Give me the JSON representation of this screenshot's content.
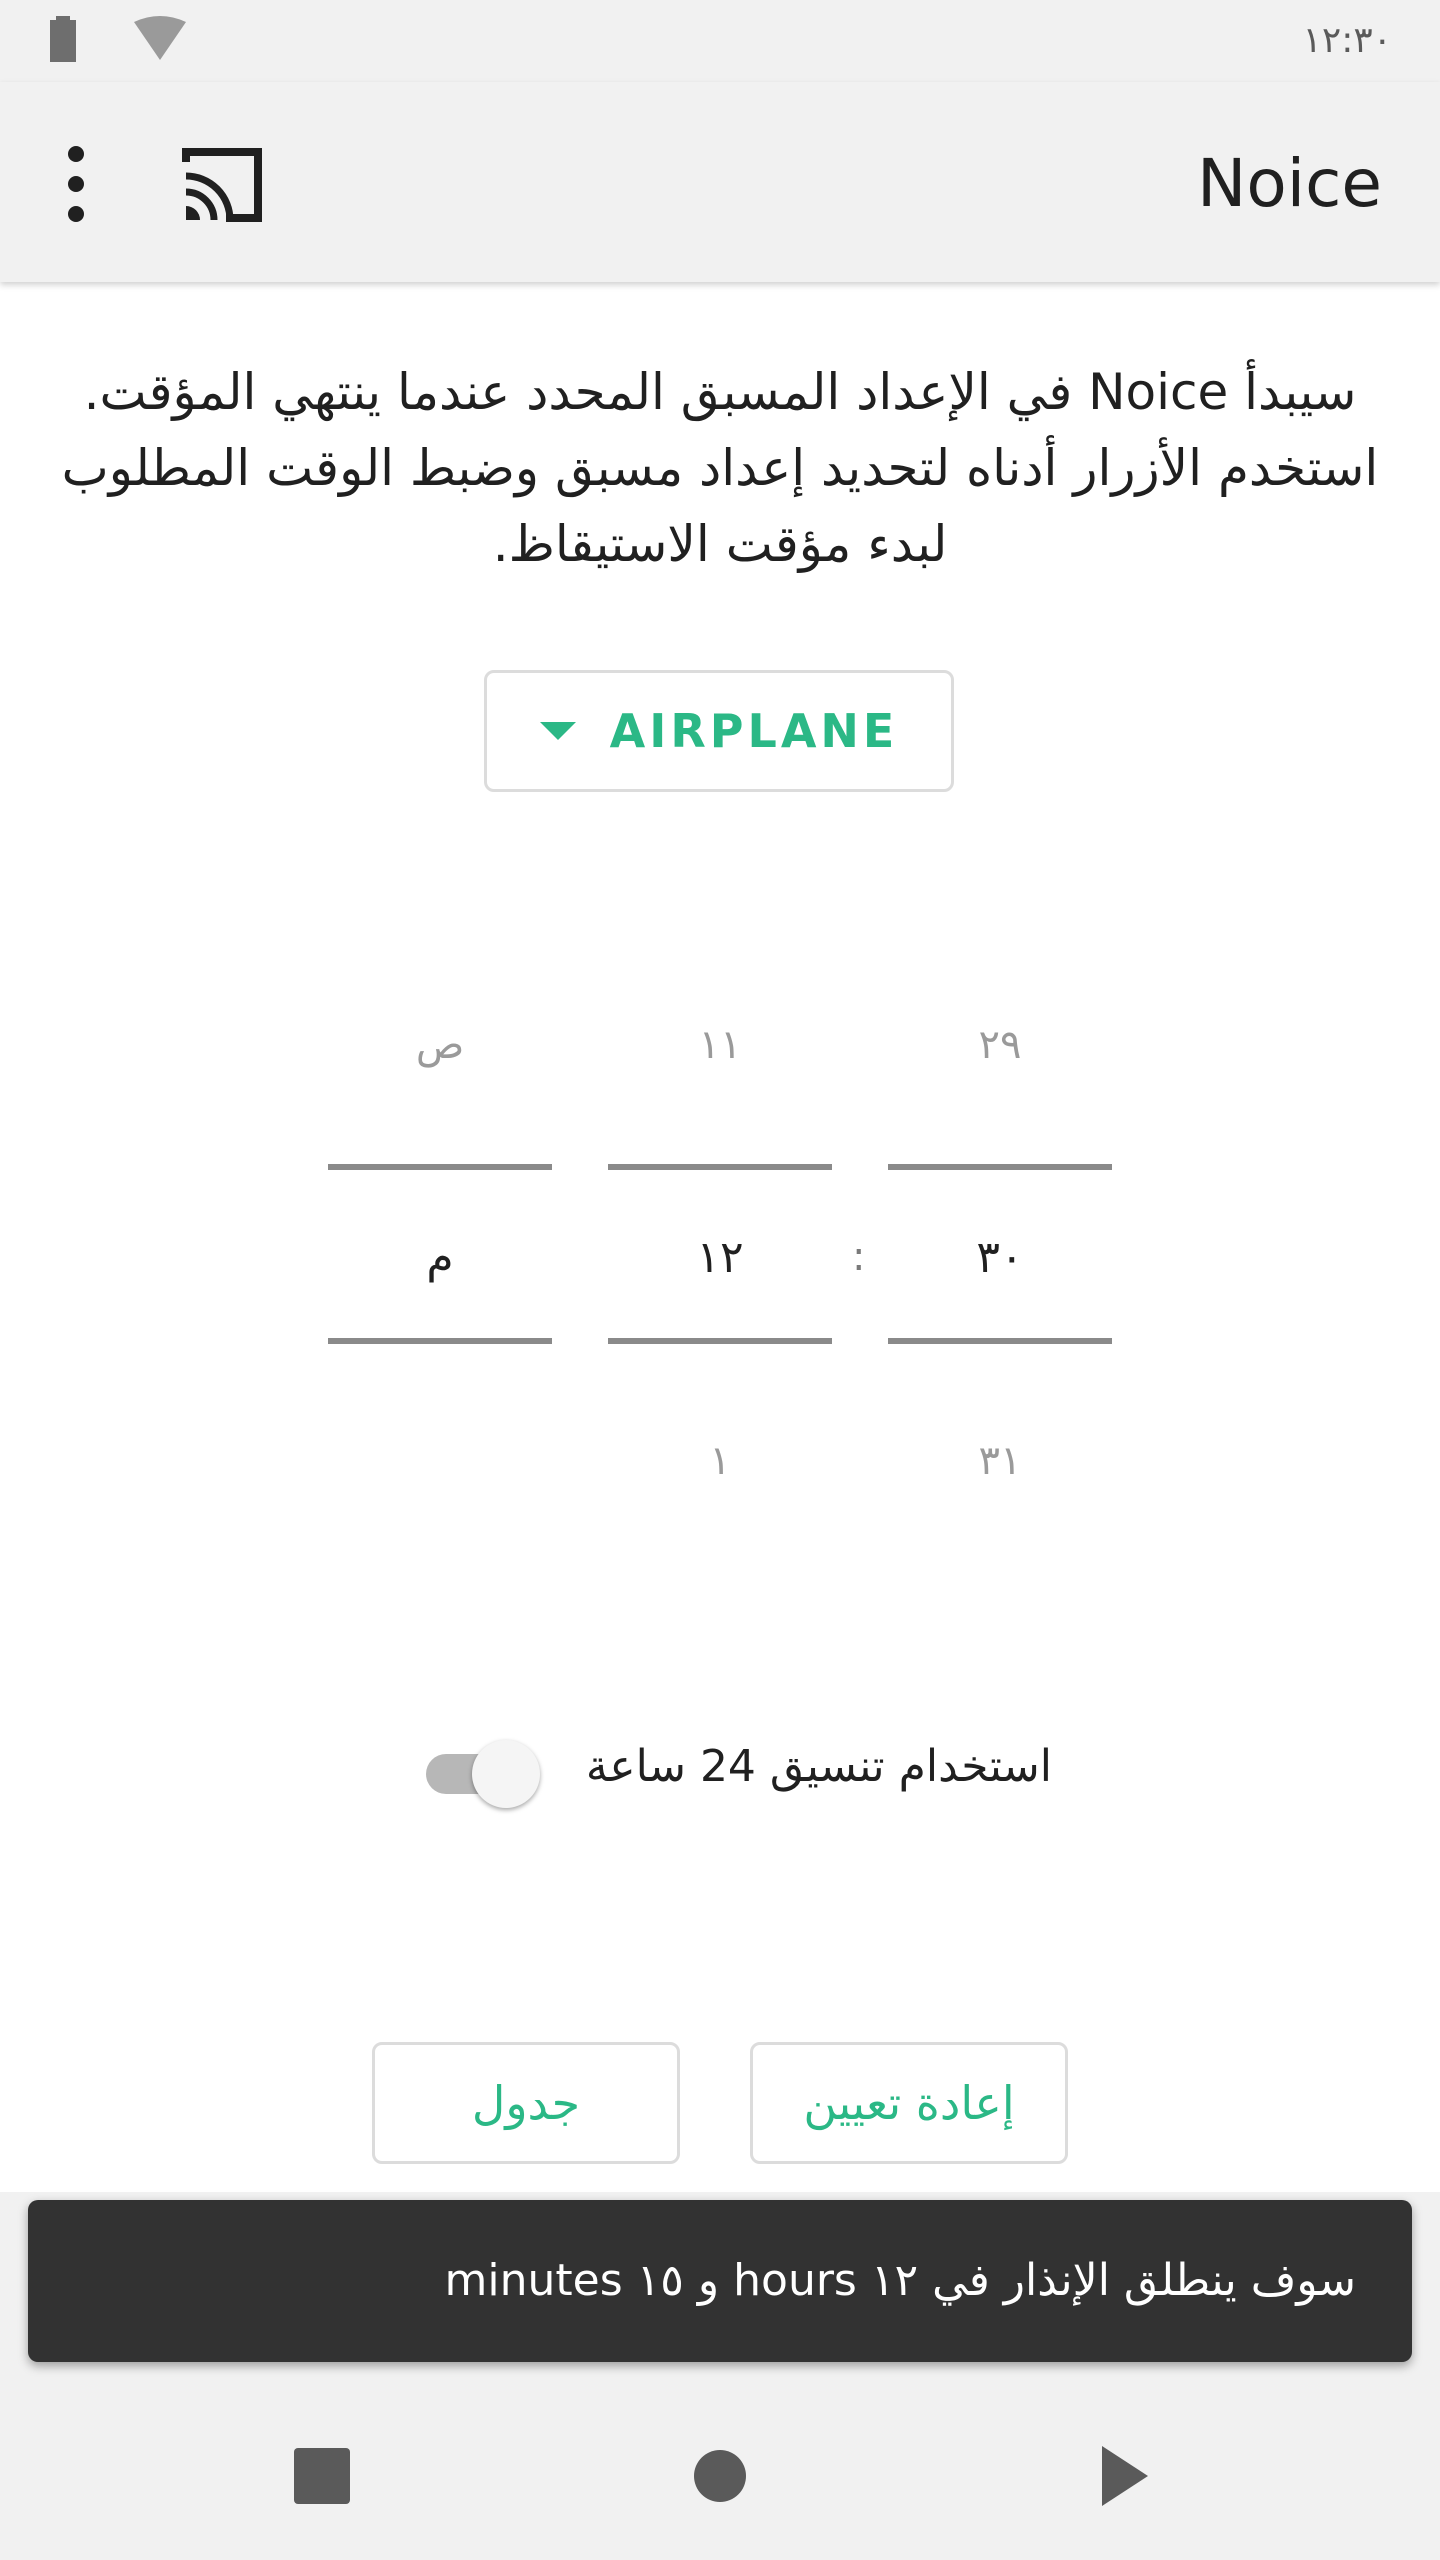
{
  "status_bar": {
    "time": "١٢:٣٠",
    "icons": [
      "battery-icon",
      "signal-icon",
      "wifi-icon"
    ]
  },
  "app_bar": {
    "title": "Noice",
    "icons": [
      "overflow-menu-icon",
      "cast-icon"
    ]
  },
  "main": {
    "description": "سيبدأ Noice في الإعداد المسبق المحدد عندما ينتهي المؤقت. استخدم الأزرار أدناه لتحديد إعداد مسبق وضبط الوقت المطلوب لبدء مؤقت الاستيقاظ.",
    "preset_label": "AIRPLANE",
    "time_picker": {
      "minutes": {
        "prev": "٢٩",
        "current": "٣٠",
        "next": "٣١"
      },
      "separator": ":",
      "hours": {
        "prev": "١١",
        "current": "١٢",
        "next": "١"
      },
      "ampm": {
        "prev": "ص",
        "current": "م",
        "next": ""
      }
    },
    "format_toggle": {
      "label": "استخدام تنسيق 24 ساعة",
      "checked": false
    },
    "buttons": {
      "reset": "إعادة تعيين",
      "schedule": "جدول"
    }
  },
  "snackbar": {
    "text": "سوف ينطلق الإنذار في ١٢ hours و ١٥ minutes"
  },
  "nav_bar": {
    "icons": [
      "recents-icon",
      "home-icon",
      "back-icon"
    ]
  },
  "colors": {
    "accent": "#2bb886",
    "bar_background": "#f1f1f1",
    "snackbar_background": "#323232"
  }
}
